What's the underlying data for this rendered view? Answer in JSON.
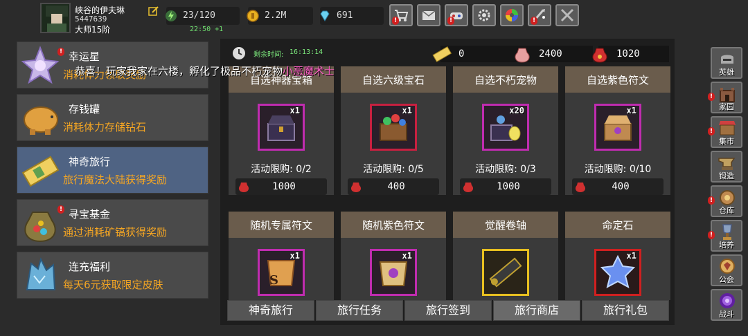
{
  "player": {
    "name": "峡谷的伊夫琳",
    "id": "5447639",
    "rank": "大师15阶"
  },
  "resources": {
    "stamina": "23/120",
    "stamina_timer": "22:50 +1",
    "gold": "2.2M",
    "gems": "691"
  },
  "toolbar": [
    {
      "icon": "shop-cart-icon",
      "alert": true
    },
    {
      "icon": "mail-icon",
      "alert": false
    },
    {
      "icon": "controller-icon",
      "alert": true
    },
    {
      "icon": "settings-gear-icon",
      "alert": false
    },
    {
      "icon": "color-wheel-icon",
      "alert": false
    },
    {
      "icon": "sword-sparkle-icon",
      "alert": true
    },
    {
      "icon": "crossed-swords-icon",
      "alert": false
    }
  ],
  "left_menu": [
    {
      "title": "幸运星",
      "desc": "消耗体力领取奖励",
      "icon": "lucky-star-icon",
      "alert": true
    },
    {
      "title": "存钱罐",
      "desc": "消耗体力存储钻石",
      "icon": "piggy-bank-icon",
      "alert": false
    },
    {
      "title": "神奇旅行",
      "desc": "旅行魔法大陆获得奖励",
      "icon": "travel-ticket-icon",
      "alert": false,
      "active": true
    },
    {
      "title": "寻宝基金",
      "desc": "通过消耗矿镐获得奖励",
      "icon": "treasure-bag-icon",
      "alert": true
    },
    {
      "title": "连充福利",
      "desc": "每天6元获取限定皮肤",
      "icon": "crystal-icon",
      "alert": false
    }
  ],
  "timer": {
    "label": "剩余时间:",
    "value": "16:13:14"
  },
  "currencies": {
    "ticket": "0",
    "bag": "2400",
    "red_bag": "1020"
  },
  "broadcast": {
    "prefix": "恭喜",
    "middle": "！玩家我家在六楼，孵化了极品不朽宠物",
    "highlight": "小恶魔术士"
  },
  "shop_items": [
    {
      "name": "自选神器宝箱",
      "qty": "x1",
      "limit": "活动限购: 0/2",
      "price": "1000",
      "frame": "#c02cb0",
      "icon": "artifact-chest-icon"
    },
    {
      "name": "自选六级宝石",
      "qty": "x1",
      "limit": "活动限购: 0/5",
      "price": "400",
      "frame": "#c82040",
      "icon": "gem-chest-icon"
    },
    {
      "name": "自选不朽宠物",
      "qty": "x20",
      "limit": "活动限购: 0/3",
      "price": "1000",
      "frame": "#c02cb0",
      "icon": "pet-egg-chest-icon"
    },
    {
      "name": "自选紫色符文",
      "qty": "x1",
      "limit": "活动限购: 0/10",
      "price": "400",
      "frame": "#c02cb0",
      "icon": "rune-chest-icon"
    },
    {
      "name": "随机专属符文",
      "qty": "x1",
      "frame": "#c02cb0",
      "icon": "exclusive-rune-icon"
    },
    {
      "name": "随机紫色符文",
      "qty": "x1",
      "frame": "#c02cb0",
      "icon": "purple-rune-icon"
    },
    {
      "name": "觉醒卷轴",
      "qty": "",
      "frame": "#e8c020",
      "icon": "awakening-scroll-icon"
    },
    {
      "name": "命定石",
      "qty": "x1",
      "frame": "#d02020",
      "icon": "destiny-stone-icon"
    }
  ],
  "tabs": [
    {
      "label": "神奇旅行"
    },
    {
      "label": "旅行任务"
    },
    {
      "label": "旅行签到"
    },
    {
      "label": "旅行商店",
      "active": true
    },
    {
      "label": "旅行礼包"
    }
  ],
  "right_nav": [
    {
      "label": "英雄",
      "icon": "hero-helmet-icon",
      "alert": false
    },
    {
      "label": "家园",
      "icon": "castle-icon",
      "alert": true
    },
    {
      "label": "集市",
      "icon": "market-stall-icon",
      "alert": true
    },
    {
      "label": "锻造",
      "icon": "anvil-icon",
      "alert": false
    },
    {
      "label": "仓库",
      "icon": "warehouse-icon",
      "alert": true
    },
    {
      "label": "培养",
      "icon": "trophy-icon",
      "alert": true
    },
    {
      "label": "公会",
      "icon": "guild-banner-icon",
      "alert": false
    },
    {
      "label": "战斗",
      "icon": "portal-icon",
      "alert": false
    }
  ],
  "colors": {
    "accent_orange": "#f5a623",
    "timer_green": "#7ce87c",
    "highlight_pink": "#ff5ec7",
    "active_menu": "#4f6383"
  }
}
